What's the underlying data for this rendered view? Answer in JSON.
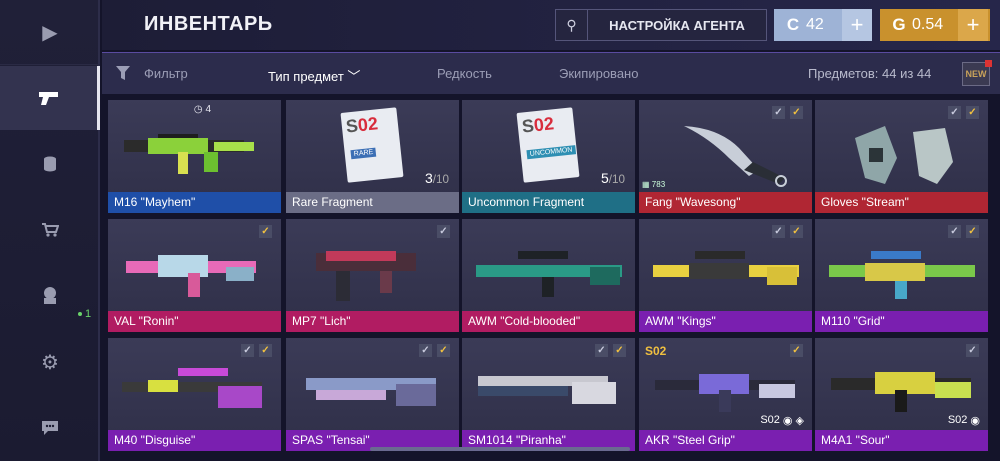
{
  "header": {
    "title": "ИНВЕНТАРЬ",
    "agent_button": "НАСТРОЙКА АГЕНТА",
    "currency_silver": "42",
    "currency_gold": "0.54"
  },
  "sidebar": {
    "items": [
      {
        "icon": "play-icon"
      },
      {
        "icon": "pistol-icon",
        "active": true
      },
      {
        "icon": "coins-icon"
      },
      {
        "icon": "cart-icon"
      },
      {
        "icon": "agent-icon",
        "badge": "1"
      },
      {
        "icon": "gear-icon"
      },
      {
        "icon": "chat-icon"
      }
    ]
  },
  "filters": {
    "filter": "Фильтр",
    "type": "Тип предмет",
    "rarity": "Редкость",
    "equipped": "Экипировано",
    "count": "Предметов: 44 из 44",
    "new_badge": "NEW"
  },
  "items": [
    {
      "name": "M16 \"Mayhem\"",
      "rarity": "r-blue",
      "timer": "4"
    },
    {
      "name": "Rare Fragment",
      "rarity": "r-grey",
      "count": "3",
      "total": "/10",
      "label": "RARE"
    },
    {
      "name": "Uncommon Fragment",
      "rarity": "r-teal",
      "count": "5",
      "total": "/10",
      "label": "UNCOMMON"
    },
    {
      "name": "Fang \"Wavesong\"",
      "rarity": "r-red",
      "stat": "783"
    },
    {
      "name": "Gloves \"Stream\"",
      "rarity": "r-red"
    },
    {
      "name": "VAL \"Ronin\"",
      "rarity": "r-pink"
    },
    {
      "name": "MP7 \"Lich\"",
      "rarity": "r-pink"
    },
    {
      "name": "AWM \"Cold-blooded\"",
      "rarity": "r-pink"
    },
    {
      "name": "AWM \"Kings\"",
      "rarity": "r-purple"
    },
    {
      "name": "M110 \"Grid\"",
      "rarity": "r-purple"
    },
    {
      "name": "M40 \"Disguise\"",
      "rarity": "r-purple"
    },
    {
      "name": "SPAS \"Tensai\"",
      "rarity": "r-purple"
    },
    {
      "name": "SM1014 \"Piranha\"",
      "rarity": "r-purple"
    },
    {
      "name": "AKR \"Steel Grip\"",
      "rarity": "r-purple"
    },
    {
      "name": "M4A1 \"Sour\"",
      "rarity": "r-purple"
    }
  ],
  "fragment_text": {
    "s": "S",
    "o": "02"
  },
  "sticker_label": "S02",
  "colors": {
    "gold": "#f0c040",
    "accent": "#5a4ba0"
  }
}
